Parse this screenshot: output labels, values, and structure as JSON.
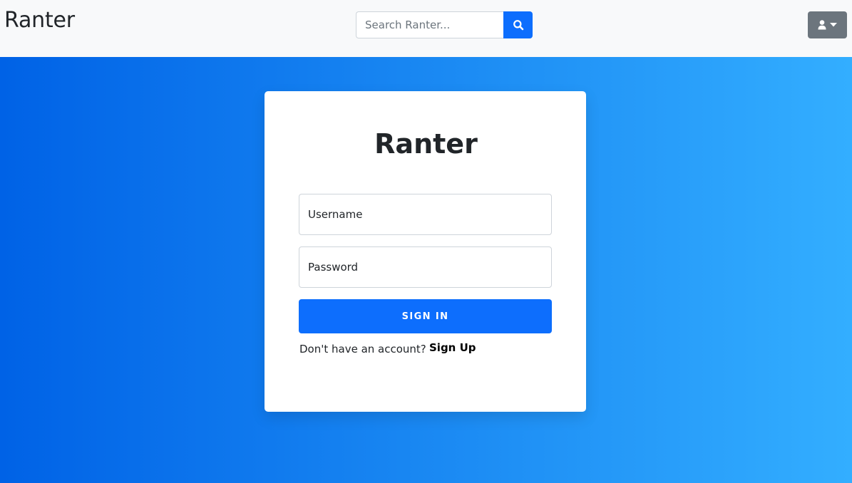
{
  "navbar": {
    "brand": "Ranter",
    "search": {
      "placeholder": "Search Ranter...",
      "value": "",
      "button_icon": "search-icon"
    },
    "user_menu": {
      "icon": "user-icon",
      "caret_icon": "caret-down-icon"
    }
  },
  "login": {
    "title": "Ranter",
    "username_placeholder": "Username",
    "password_placeholder": "Password",
    "signin_label": "SIGN IN",
    "signup_prompt": "Don't have an account?",
    "signup_label": "Sign Up"
  },
  "colors": {
    "primary": "#0d6efd",
    "secondary": "#6c757d",
    "navbar_bg": "#f8f9fa",
    "gradient_start": "#0062e6",
    "gradient_end": "#33aeff"
  }
}
